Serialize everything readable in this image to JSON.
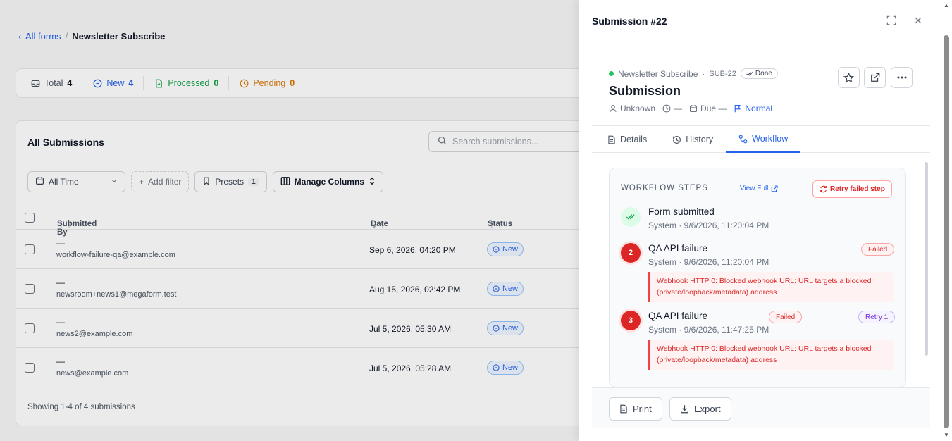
{
  "breadcrumb": {
    "back": "‹",
    "link": "All forms",
    "sep": "/",
    "current": "Newsletter Subscribe"
  },
  "stats": [
    {
      "label": "Total",
      "value": "4",
      "color": "#111827"
    },
    {
      "label": "New",
      "value": "4",
      "color": "#2563eb"
    },
    {
      "label": "Processed",
      "value": "0",
      "color": "#16a34a"
    },
    {
      "label": "Pending",
      "value": "0",
      "color": "#d97706"
    }
  ],
  "card": {
    "title": "All Submissions",
    "search_placeholder": "Search submissions...",
    "filters": {
      "time": "All Time",
      "add_filter": "Add filter",
      "presets": "Presets",
      "presets_count": "1",
      "manage_columns": "Manage Columns"
    },
    "columns": {
      "submitted_by": "Submitted By",
      "date": "Date",
      "status": "Status"
    },
    "rows": [
      {
        "name": "—",
        "email": "workflow-failure-qa@example.com",
        "date": "Sep 6, 2026, 04:20 PM",
        "status": "New"
      },
      {
        "name": "—",
        "email": "newsroom+news1@megaform.test",
        "date": "Aug 15, 2026, 02:42 PM",
        "status": "New"
      },
      {
        "name": "—",
        "email": "news2@example.com",
        "date": "Jul 5, 2026, 05:30 AM",
        "status": "New"
      },
      {
        "name": "—",
        "email": "news@example.com",
        "date": "Jul 5, 2026, 05:28 AM",
        "status": "New"
      }
    ],
    "footer": "Showing 1-4 of 4 submissions"
  },
  "drawer": {
    "title": "Submission #22",
    "form_name": "Newsletter Subscribe",
    "meta_sep": "·",
    "sub_id": "SUB-22",
    "state": "Done",
    "heading": "Submission",
    "assignee": "Unknown",
    "time": "—",
    "due": "Due —",
    "priority": "Normal",
    "tabs": [
      "Details",
      "History",
      "Workflow"
    ],
    "workflow": {
      "heading": "WORKFLOW STEPS",
      "view_full": "View Full",
      "retry": "Retry failed step",
      "steps": [
        {
          "num": "",
          "name": "Form submitted",
          "sub": "System · 9/6/2026, 11:20:04 PM"
        },
        {
          "num": "2",
          "name": "QA API failure",
          "sub": "System · 9/6/2026, 11:20:04 PM",
          "badge": "Failed",
          "error": "Webhook HTTP 0: Blocked webhook URL: URL targets a blocked (private/loopback/metadata) address"
        },
        {
          "num": "3",
          "name": "QA API failure",
          "sub": "System · 9/6/2026, 11:47:25 PM",
          "badge": "Failed",
          "retry": "Retry 1",
          "error": "Webhook HTTP 0: Blocked webhook URL: URL targets a blocked (private/loopback/metadata) address"
        }
      ]
    },
    "footer": {
      "print": "Print",
      "export": "Export"
    }
  }
}
